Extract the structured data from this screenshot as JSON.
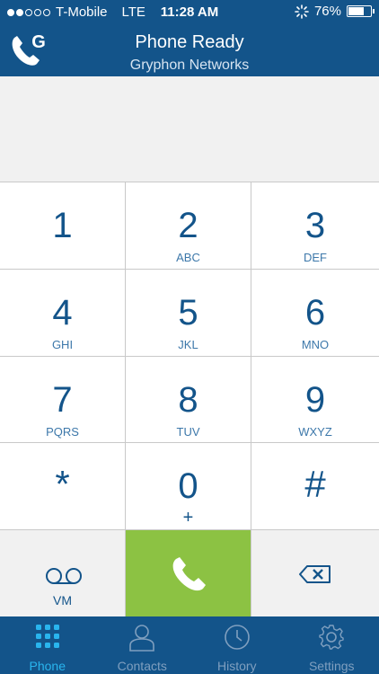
{
  "status": {
    "carrier": "T-Mobile",
    "network": "LTE",
    "time": "11:28 AM",
    "battery": "76%",
    "battery_level": 0.76
  },
  "header": {
    "title": "Phone Ready",
    "subtitle": "Gryphon Networks",
    "logo_letter": "G"
  },
  "keypad": {
    "keys": [
      {
        "digit": "1",
        "letters": ""
      },
      {
        "digit": "2",
        "letters": "ABC"
      },
      {
        "digit": "3",
        "letters": "DEF"
      },
      {
        "digit": "4",
        "letters": "GHI"
      },
      {
        "digit": "5",
        "letters": "JKL"
      },
      {
        "digit": "6",
        "letters": "MNO"
      },
      {
        "digit": "7",
        "letters": "PQRS"
      },
      {
        "digit": "8",
        "letters": "TUV"
      },
      {
        "digit": "9",
        "letters": "WXYZ"
      },
      {
        "digit": "*",
        "letters": ""
      },
      {
        "digit": "0",
        "letters": "+"
      },
      {
        "digit": "#",
        "letters": ""
      }
    ],
    "voicemail_label": "VM"
  },
  "tabs": [
    {
      "label": "Phone",
      "icon": "keypad-icon",
      "active": true
    },
    {
      "label": "Contacts",
      "icon": "person-icon",
      "active": false
    },
    {
      "label": "History",
      "icon": "clock-icon",
      "active": false
    },
    {
      "label": "Settings",
      "icon": "gear-icon",
      "active": false
    }
  ],
  "colors": {
    "header": "#13548a",
    "call": "#8cc243",
    "active_tab": "#29b5ee",
    "digits": "#13548a"
  }
}
